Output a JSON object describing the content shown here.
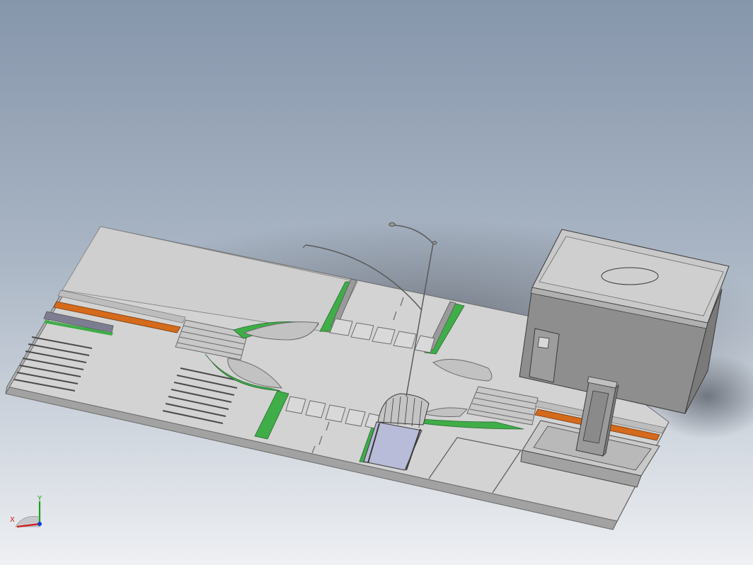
{
  "viewport": {
    "background_top": "#8696ab",
    "background_bottom": "#eef0f3",
    "colors": {
      "slab": "#d3d3d3",
      "slab_edge": "#a2a2a2",
      "green_strip": "#3fad48",
      "orange_strip": "#d46a1b",
      "building_wall": "#8e8e8e",
      "building_roof": "#c9c9c9",
      "line": "#4a4a4a"
    }
  },
  "scene": {
    "objects": [
      "road-slab",
      "crosswalk-west",
      "crosswalk-east",
      "street-lamp",
      "bus-shelter",
      "building",
      "kiosk",
      "raised-planter"
    ]
  },
  "triad": {
    "x_label": "X",
    "y_label": "Y",
    "x_color": "#d21a1a",
    "y_color": "#1aa21a",
    "z_color": "#1a38d2"
  }
}
